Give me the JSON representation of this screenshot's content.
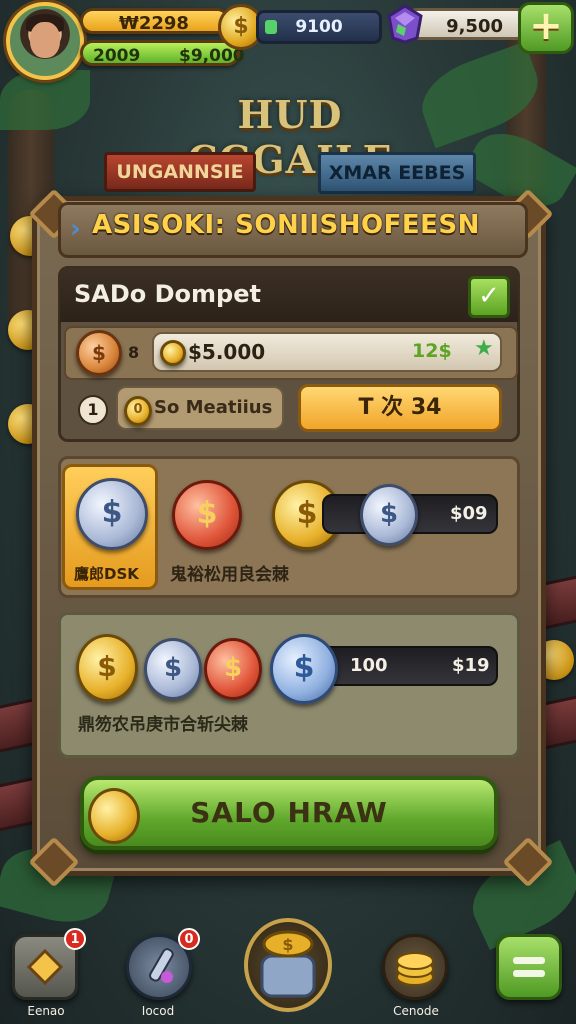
{
  "hud": {
    "gold_amount": "₩2298",
    "coin_symbol": "$",
    "green_left": "2009",
    "green_right": "$9,000",
    "gem_amount": "9100",
    "crystal_amount": "9,500",
    "plus_label": "+"
  },
  "background": {
    "title": "HUD CGGAILE",
    "sign_left": "UNGANNSIE",
    "sign_right": "XMAR EEBES"
  },
  "panel": {
    "header_arrow": "›",
    "title": "ASISOKI: SONIISHOFEESN",
    "dompet_title": "SADo Dompet",
    "check": "✓",
    "wallet_coin": "$",
    "multiplier": "8",
    "amount": "$5.000",
    "bonus": "12$",
    "star": "★",
    "method_number": "1",
    "method_coin": "0",
    "method_label": "So Meatiius",
    "tx_button": "T 次 34",
    "mid": {
      "selected_coin": "$",
      "selected_label": "鷹郎DSK",
      "red_coin": "$",
      "gold_coin": "$",
      "silver_coin": "$",
      "track_value": "$09",
      "caption": "鬼裕松用良会棘"
    },
    "bot": {
      "coins": [
        "$",
        "$",
        "$",
        "$"
      ],
      "track_left": "100",
      "track_right": "$19",
      "caption": "鼎笏农吊庚市合斩尖棘"
    },
    "withdraw_button": "SALO HRAW"
  },
  "nav": {
    "left_label": "Eenao",
    "left_badge": "1",
    "second_label": "Iocod",
    "second_badge": "0",
    "fourth_label": "Cenode",
    "menu_icon": "menu-icon"
  },
  "colors": {
    "gold": "#e9a21b",
    "green": "#5fa82c",
    "panel_bg": "#6b5a44",
    "title_yellow": "#ffd24a"
  }
}
